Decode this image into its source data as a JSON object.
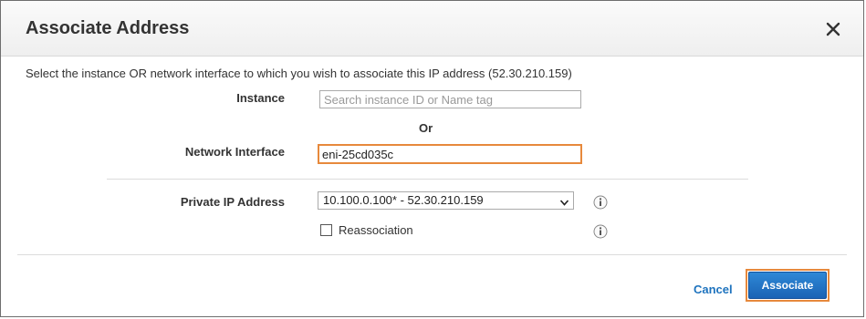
{
  "dialog": {
    "title": "Associate Address",
    "close_icon": "close-icon"
  },
  "intro_text": "Select the instance OR network interface to which you wish to associate this IP address (52.30.210.159)",
  "instance": {
    "label": "Instance",
    "value": "",
    "placeholder": "Search instance ID or Name tag"
  },
  "or_text": "Or",
  "network_interface": {
    "label": "Network Interface",
    "value": "eni-25cd035c"
  },
  "private_ip": {
    "label": "Private IP Address",
    "selected": "10.100.0.100* - 52.30.210.159"
  },
  "reassociation": {
    "label": "Reassociation",
    "checked": false
  },
  "footer": {
    "cancel_label": "Cancel",
    "associate_label": "Associate"
  },
  "colors": {
    "focus_orange": "#e7893c",
    "link_blue": "#1e73be",
    "button_blue": "#1a63b5"
  }
}
